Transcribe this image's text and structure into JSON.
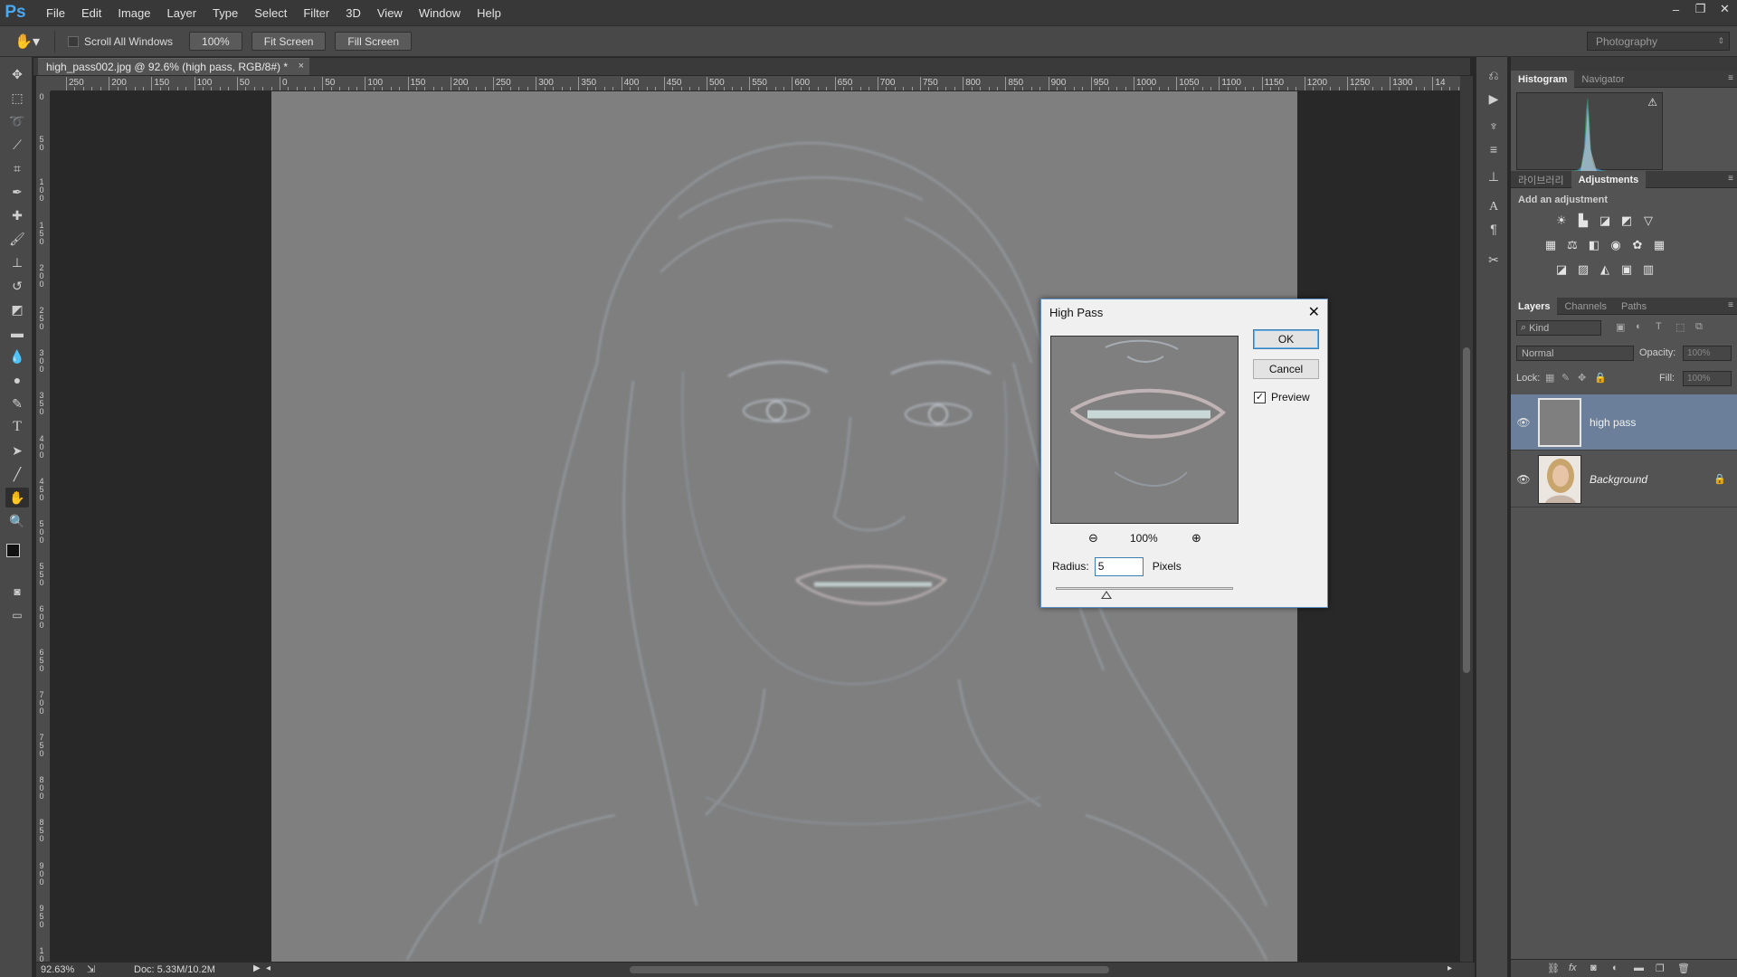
{
  "app": {
    "logo": "Ps"
  },
  "menu": [
    "File",
    "Edit",
    "Image",
    "Layer",
    "Type",
    "Select",
    "Filter",
    "3D",
    "View",
    "Window",
    "Help"
  ],
  "window_controls": [
    "–",
    "❐",
    "✕"
  ],
  "options_bar": {
    "scroll_all_windows": "Scroll All Windows",
    "zoom_100": "100%",
    "fit_screen": "Fit Screen",
    "fill_screen": "Fill Screen",
    "workspace": "Photography"
  },
  "document": {
    "tab_title": "high_pass002.jpg @ 92.6% (high pass, RGB/8#) *",
    "close": "×"
  },
  "ruler_top_labels": [
    "250",
    "200",
    "150",
    "100",
    "50",
    "0",
    "50",
    "100",
    "150",
    "200",
    "250",
    "300",
    "350",
    "400",
    "450",
    "500",
    "550",
    "600",
    "650",
    "700",
    "750",
    "800",
    "850",
    "900",
    "950",
    "1000",
    "1050",
    "1100",
    "1150",
    "1200",
    "1250",
    "1300",
    "14"
  ],
  "ruler_left_labels": [
    "0",
    "50",
    "100",
    "150",
    "200",
    "250",
    "300",
    "350",
    "400",
    "450",
    "500",
    "550",
    "600",
    "650",
    "700",
    "750",
    "800",
    "850",
    "900",
    "950",
    "100"
  ],
  "status": {
    "zoom": "92.63%",
    "doc": "Doc: 5.33M/10.2M"
  },
  "panels": {
    "histogram_tabs": [
      "Histogram",
      "Navigator"
    ],
    "adjustments_tabs": [
      "라이브러리",
      "Adjustments"
    ],
    "add_adjustment": "Add an adjustment",
    "layers_tabs": [
      "Layers",
      "Channels",
      "Paths"
    ],
    "kind": "Kind",
    "blend_mode": "Normal",
    "opacity_label": "Opacity:",
    "opacity_value": "100%",
    "lock_label": "Lock:",
    "fill_label": "Fill:",
    "fill_value": "100%",
    "layers": [
      {
        "name": "high pass",
        "selected": true
      },
      {
        "name": "Background",
        "selected": false,
        "locked": true
      }
    ]
  },
  "dialog": {
    "title": "High Pass",
    "ok": "OK",
    "cancel": "Cancel",
    "preview": "Preview",
    "preview_checked": true,
    "zoom": "100%",
    "radius_label": "Radius:",
    "radius_value": "5",
    "unit": "Pixels"
  },
  "colors": {
    "accent": "#4aa8f0",
    "selected_layer": "#6b7f9a",
    "dialog_border": "#5a8fc7"
  }
}
